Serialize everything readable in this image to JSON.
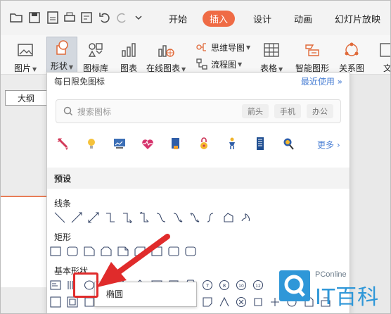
{
  "menu": {
    "tabs": [
      "开始",
      "插入",
      "设计",
      "动画",
      "幻灯片放映"
    ],
    "active": "插入"
  },
  "ribbon": {
    "picture": "图片",
    "shape": "形状",
    "icon_lib": "图标库",
    "chart": "图表",
    "online_chart": "在线图表",
    "mindmap": "思维导图",
    "flowchart": "流程图",
    "table": "表格",
    "smart_graphic": "智能图形",
    "relation": "关系图",
    "text_partial": "文"
  },
  "outline_button": "大纲",
  "panel": {
    "header": "每日限免图标",
    "recent": "最近使用",
    "search_placeholder": "搜索图标",
    "chips": [
      "箭头",
      "手机",
      "办公"
    ],
    "more": "更多",
    "preset_title": "预设",
    "categories": {
      "lines": "线条",
      "rect": "矩形",
      "basic": "基本形状"
    }
  },
  "tooltip": "椭圆",
  "watermark": {
    "brand": "PConline",
    "name": "IT百科"
  },
  "colors": {
    "accent": "#ef6b45",
    "link": "#4a7fd4",
    "annotation": "#e02b2b",
    "watermark": "#2f97d8"
  }
}
